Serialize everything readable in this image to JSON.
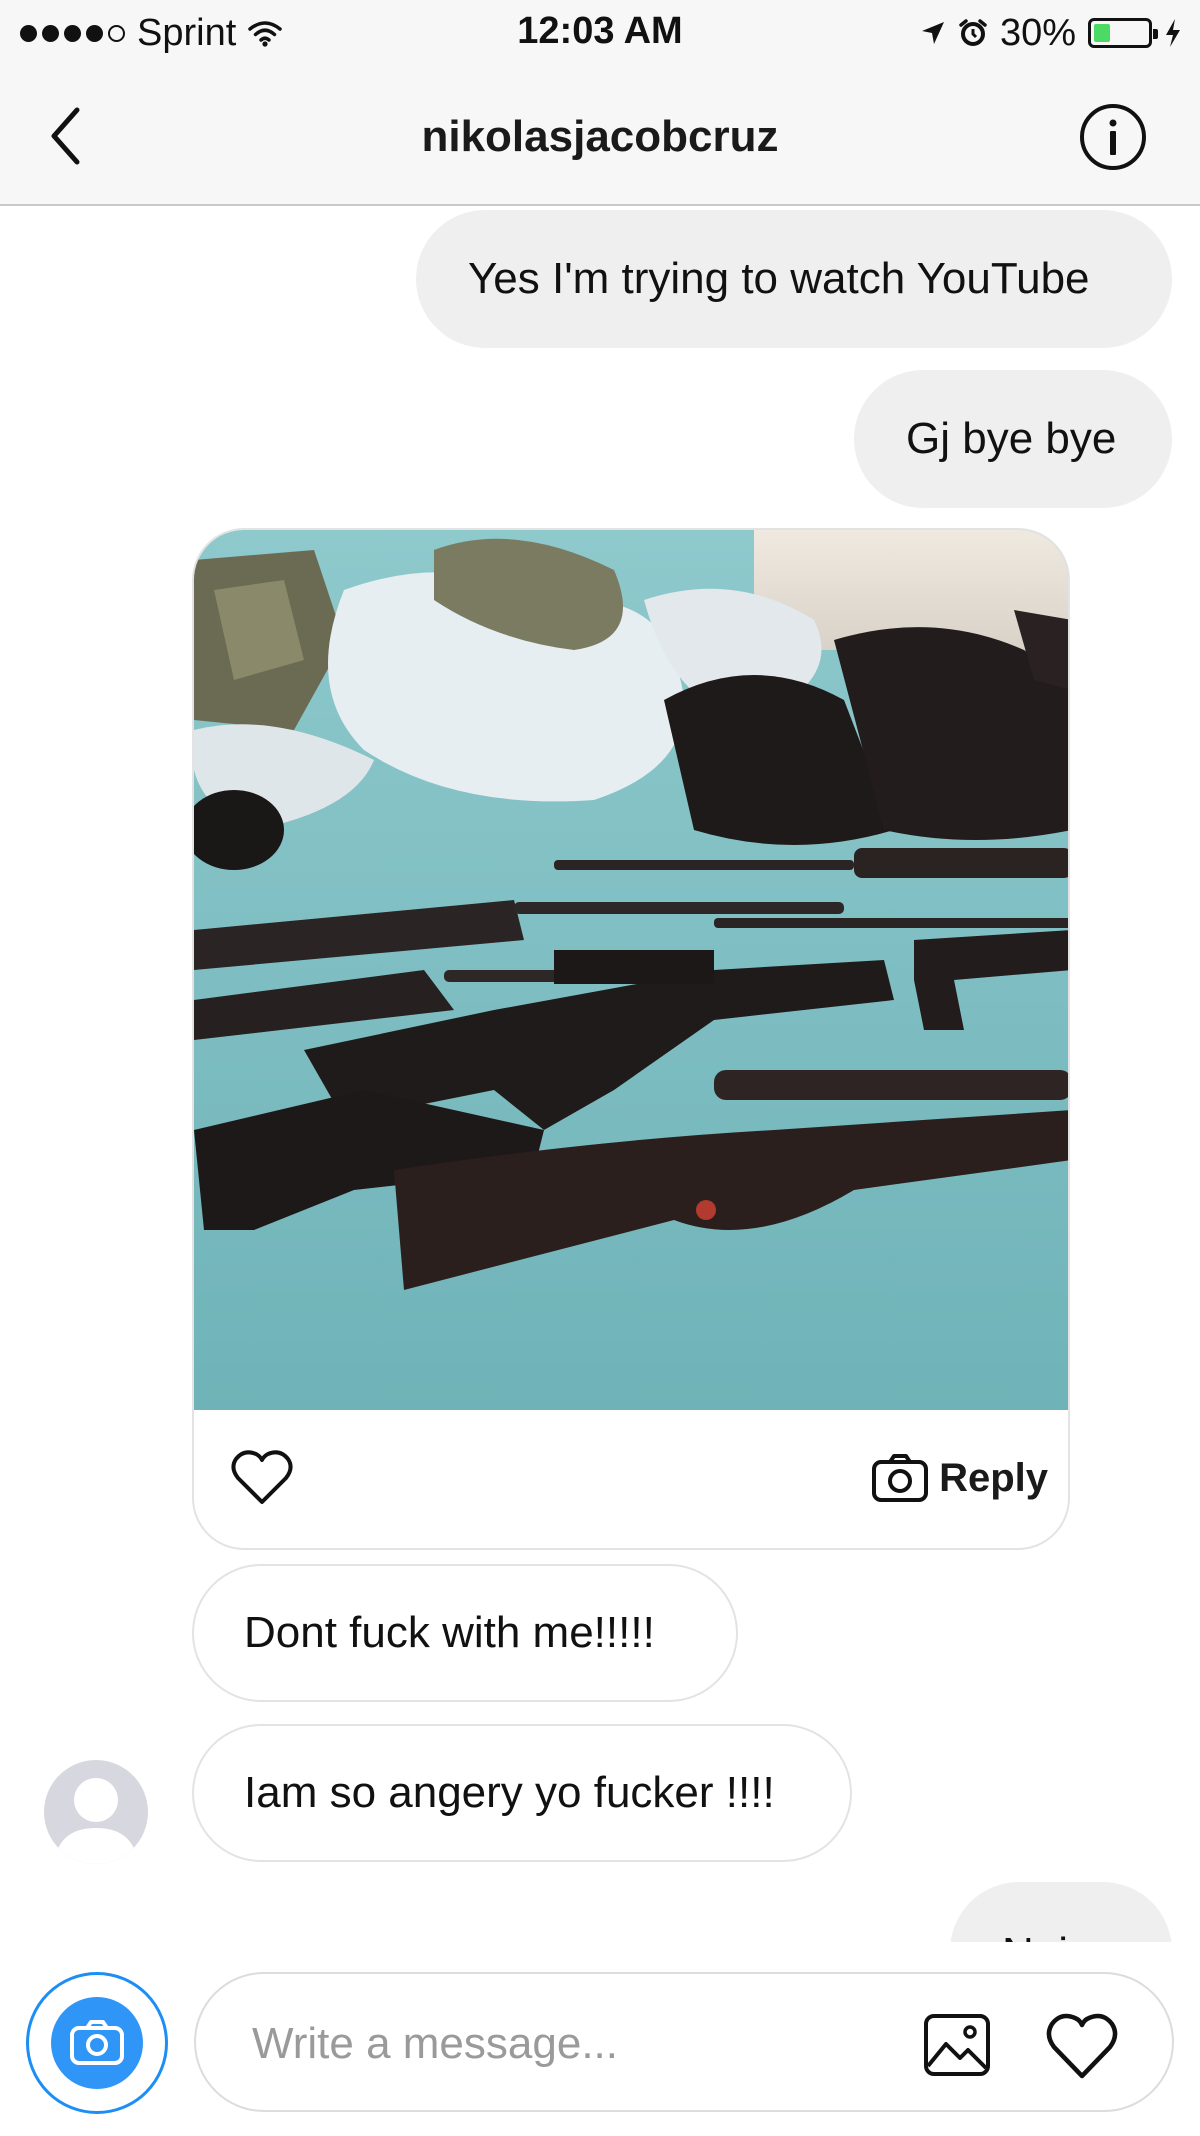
{
  "status_bar": {
    "carrier": "Sprint",
    "time": "12:03 AM",
    "battery_text": "30%",
    "battery_level": 0.3,
    "signal_icons": "signal-dots-icon",
    "wifi_icon": "wifi-icon",
    "location_icon": "location-arrow-icon",
    "alarm_icon": "alarm-clock-icon",
    "charging_icon": "charging-bolt-icon"
  },
  "header": {
    "title": "nikolasjacobcruz",
    "back_icon": "chevron-left-icon",
    "info_icon": "info-icon"
  },
  "messages": [
    {
      "direction": "outgoing",
      "text": "Yes I'm trying to watch YouTube"
    },
    {
      "direction": "outgoing",
      "text": "Gj bye bye"
    },
    {
      "direction": "incoming",
      "type": "photo",
      "reply_label": "Reply",
      "like_icon": "heart-icon",
      "reply_icon": "camera-icon"
    },
    {
      "direction": "incoming",
      "text": "Dont fuck with me!!!!!"
    },
    {
      "direction": "incoming",
      "text": "Iam so angery yo fucker !!!!"
    },
    {
      "direction": "outgoing",
      "text": "Noice",
      "partially_visible": true
    }
  ],
  "composer": {
    "placeholder": "Write a message...",
    "camera_icon": "camera-icon",
    "gallery_icon": "gallery-icon",
    "like_icon": "heart-icon"
  },
  "colors": {
    "accent_blue": "#2f96f7",
    "outgoing_bubble": "#efefef",
    "incoming_border": "#e3e3e3",
    "battery_green": "#4cd964",
    "bar_background": "#f7f7f7"
  }
}
